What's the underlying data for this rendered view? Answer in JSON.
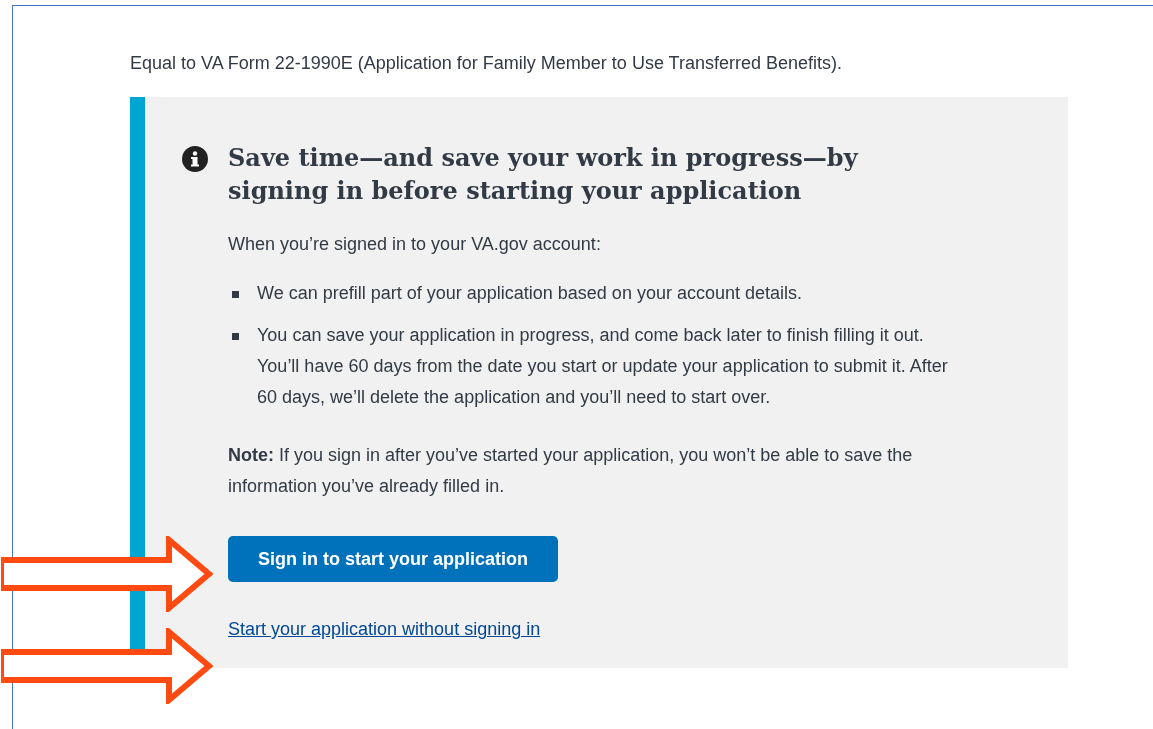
{
  "intro": "Equal to VA Form 22-1990E (Application for Family Member to Use Transferred Benefits).",
  "alert": {
    "heading": "Save time—and save your work in progress—by signing in before starting your application",
    "lead": "When you’re signed in to your VA.gov account:",
    "bullets": [
      "We can prefill part of your application based on your account details.",
      "You can save your application in progress, and come back later to finish filling it out. You’ll have 60 days from the date you start or update your application to submit it. After 60 days, we’ll delete the application and you’ll need to start over."
    ],
    "note": "**Note:** If you sign in after you’ve started your application, you won’t be able to save the information you’ve already filled in.",
    "button": "Sign in to start your application",
    "link": "Start your application without signing in"
  }
}
